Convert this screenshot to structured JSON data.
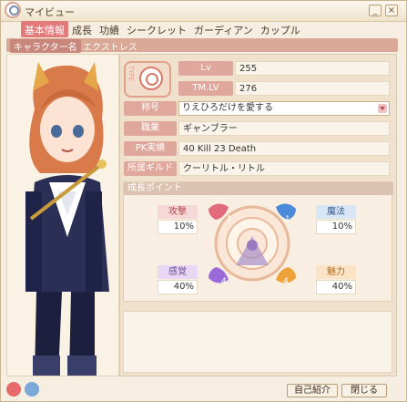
{
  "window": {
    "title": "マイビュー"
  },
  "tabs": [
    {
      "label": "基本情報",
      "active": true
    },
    {
      "label": "成長"
    },
    {
      "label": "功績"
    },
    {
      "label": "シークレット"
    },
    {
      "label": "ガーディアン"
    },
    {
      "label": "カップル"
    }
  ],
  "character": {
    "name_label": "キャラクター名",
    "name_value": "エクストレス"
  },
  "stats": {
    "lv_label": "Lv",
    "lv_value": "255",
    "tmlv_label": "TM.LV",
    "tmlv_value": "276",
    "title_label": "称号",
    "title_value": "りえひろだけを愛する",
    "job_label": "職業",
    "job_value": "ギャンブラー",
    "pk_label": "PK実績",
    "pk_value": "40 Kill  23 Death",
    "guild_label": "所属ギルド",
    "guild_value": "クーリトル・リトル"
  },
  "growth": {
    "header": "成長ポイント",
    "attack": {
      "label": "攻撃",
      "value": "10%"
    },
    "magic": {
      "label": "魔法",
      "value": "10%"
    },
    "sense": {
      "label": "感覚",
      "value": "40%"
    },
    "charm": {
      "label": "魅力",
      "value": "40%"
    },
    "badges": {
      "tl": "1",
      "tr": "1",
      "bl": "4",
      "br": "4"
    }
  },
  "footer": {
    "intro_button": "自己紹介",
    "close_button": "閉じる"
  },
  "colors": {
    "accent": "#e37a7a",
    "label_bg": "#e0a79c",
    "panel_bg": "#efe1cc"
  }
}
